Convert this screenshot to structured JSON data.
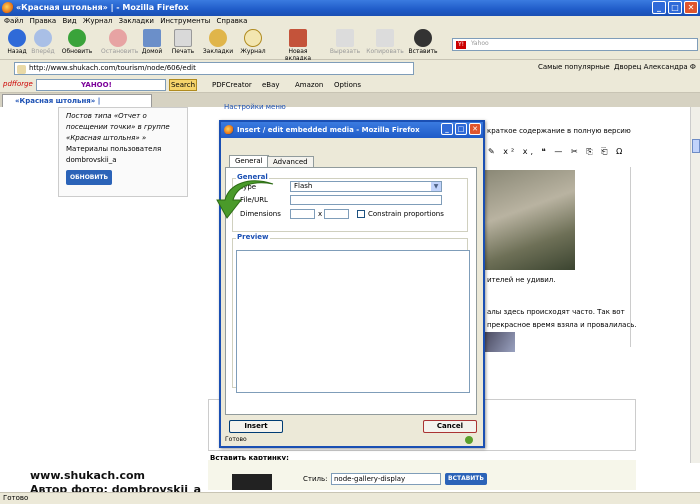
{
  "window": {
    "title": "«Красная штольня» | - Mozilla Firefox"
  },
  "menu": [
    "Файл",
    "Правка",
    "Вид",
    "Журнал",
    "Закладки",
    "Инструменты",
    "Справка"
  ],
  "nav": [
    {
      "label": "Назад",
      "icon": "back-arrow-icon"
    },
    {
      "label": "Вперёд",
      "icon": "forward-arrow-icon"
    },
    {
      "label": "Обновить",
      "icon": "reload-icon"
    },
    {
      "label": "Остановить",
      "icon": "stop-icon"
    },
    {
      "label": "Домой",
      "icon": "home-icon"
    },
    {
      "label": "Печать",
      "icon": "print-icon"
    },
    {
      "label": "Закладки",
      "icon": "bookmarks-icon"
    },
    {
      "label": "Журнал",
      "icon": "history-icon"
    },
    {
      "label": "Новая вкладка",
      "icon": "new-tab-icon"
    },
    {
      "label": "Вырезать",
      "icon": "cut-icon"
    },
    {
      "label": "Копировать",
      "icon": "copy-icon"
    },
    {
      "label": "Вставить",
      "icon": "paste-icon"
    }
  ],
  "search_engine_placeholder": "Yahoo",
  "address": {
    "url": "http://www.shukach.com/tourism/node/606/edit"
  },
  "bookmarks": [
    "Самые популярные",
    "Дворец Александра Ф"
  ],
  "toolbar2": {
    "brand": "pdfforge",
    "search_label": "Search",
    "items": [
      "PDFCreator",
      "eBay",
      "Amazon",
      "Options"
    ]
  },
  "tab": {
    "title": "«Красная штольня» |"
  },
  "page": {
    "settings_link": "Настройки меню",
    "sidebar_lines": [
      "Постов типа «Отчет о",
      "посещении точки» в группе",
      "«Красная штольня» »",
      "Материалы пользователя",
      "dombrovskii_a"
    ],
    "refresh_button": "ОБНОВИТЬ",
    "summary_fragment": "краткое содержание в полную версию",
    "text_fragment_1": "ителей не удивил.",
    "text_fragment_2": "алы здесь происходят часто. Так вот",
    "text_fragment_3": "прекрасное время взяла и провалилась.",
    "insert_picture_label": "Вставить картинку:",
    "style_label": "Стиль:",
    "style_value": "node-gallery-display",
    "insert_button": "ВСТАВИТЬ"
  },
  "dialog": {
    "title": "Insert / edit embedded media - Mozilla Firefox",
    "tabs": [
      "General",
      "Advanced"
    ],
    "general_legend": "General",
    "type_label": "Type",
    "type_value": "Flash",
    "file_label": "File/URL",
    "dimensions_label": "Dimensions",
    "times": "x",
    "constrain_label": "Constrain proportions",
    "preview_legend": "Preview",
    "insert_button": "Insert",
    "cancel_button": "Cancel",
    "status": "Готово"
  },
  "statusbar": {
    "text": "Готово"
  },
  "caption": {
    "line1": "www.shukach.com",
    "line2": "Автор фото: dombrovskii_a"
  }
}
